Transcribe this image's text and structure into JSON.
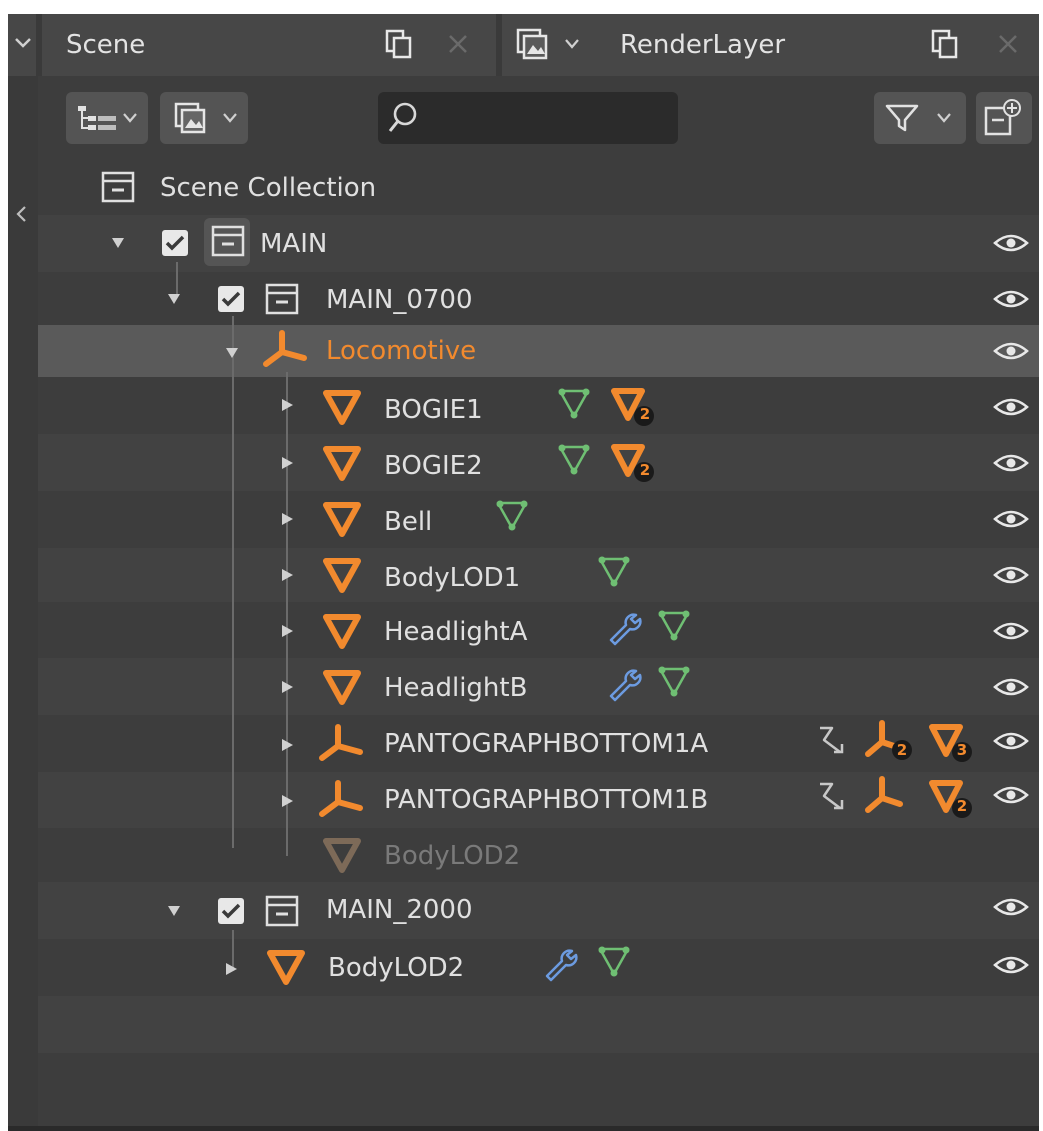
{
  "header": {
    "scene_label": "Scene",
    "layer_label": "RenderLayer"
  },
  "toolbar": {
    "search_placeholder": ""
  },
  "tree": {
    "scene_collection": "Scene Collection",
    "main": "MAIN",
    "main_0700": "MAIN_0700",
    "locomotive": "Locomotive",
    "objects": [
      {
        "label": "BOGIE1",
        "badges": [
          "vertex-group-icon",
          "mesh-data-icon"
        ],
        "mesh_count": "2"
      },
      {
        "label": "BOGIE2",
        "badges": [
          "vertex-group-icon",
          "mesh-data-icon"
        ],
        "mesh_count": "2"
      },
      {
        "label": "Bell",
        "badges": [
          "vertex-group-icon"
        ]
      },
      {
        "label": "BodyLOD1",
        "badges": [
          "vertex-group-icon"
        ]
      },
      {
        "label": "HeadlightA",
        "badges": [
          "modifier-icon",
          "vertex-group-icon"
        ]
      },
      {
        "label": "HeadlightB",
        "badges": [
          "modifier-icon",
          "vertex-group-icon"
        ]
      },
      {
        "label": "PANTOGRAPHBOTTOM1A",
        "badges": [
          "constraint-icon",
          "armature-icon",
          "mesh-data-icon"
        ],
        "armature_count": "2",
        "mesh_count": "3"
      },
      {
        "label": "PANTOGRAPHBOTTOM1B",
        "badges": [
          "constraint-icon",
          "armature-icon",
          "mesh-data-icon"
        ],
        "mesh_count": "2"
      },
      {
        "label": "BodyLOD2",
        "badges": []
      }
    ],
    "main_2000": "MAIN_2000",
    "main_2000_child": "BodyLOD2"
  },
  "colors": {
    "accent_orange": "#f28a2e",
    "vertex_group_green": "#6fbf73",
    "modifier_blue": "#6c9be0",
    "panel_bg": "#3d3d3d"
  }
}
